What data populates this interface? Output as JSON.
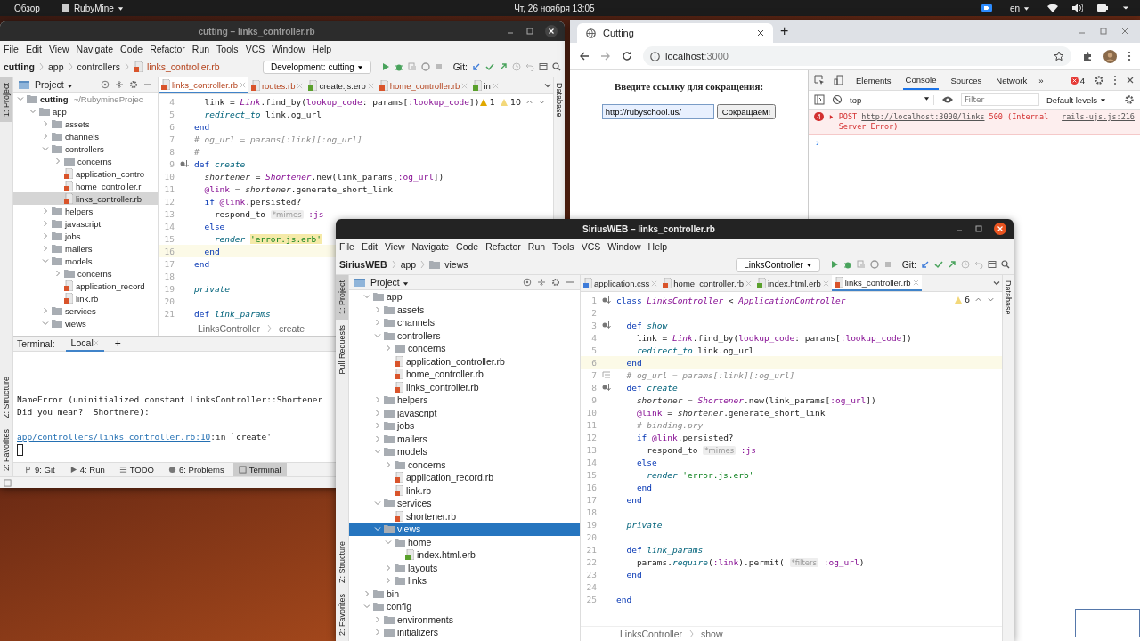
{
  "top_bar": {
    "activities": "Обзор",
    "app_menu": "RubyMine",
    "clock": "Чт, 26 ноября  13:05",
    "language": "en"
  },
  "ide_back": {
    "title": "cutting – links_controller.rb",
    "menu": [
      "File",
      "Edit",
      "View",
      "Navigate",
      "Code",
      "Refactor",
      "Run",
      "Tools",
      "VCS",
      "Window",
      "Help"
    ],
    "breadcrumb": [
      {
        "label": "cutting",
        "kind": "project"
      },
      {
        "label": "app",
        "kind": "plain"
      },
      {
        "label": "controllers",
        "kind": "plain"
      },
      {
        "label": "links_controller.rb",
        "kind": "ruby"
      }
    ],
    "run_config": "Development: cutting",
    "git_label": "Git:",
    "left_stripe": [
      {
        "label": "1: Project",
        "selected": true
      }
    ],
    "left_stripe_bottom": [
      {
        "label": "Z: Structure",
        "selected": false
      },
      {
        "label": "2: Favorites",
        "selected": false
      }
    ],
    "right_stripe": [
      "Database"
    ],
    "project_panel": {
      "title": "Project",
      "tree": [
        {
          "label": "cutting",
          "path": "~/RubymineProjec",
          "kind": "project",
          "expanded": true,
          "selected": false,
          "children": [
            {
              "label": "app",
              "kind": "folder",
              "expanded": true,
              "selected": false,
              "children": [
                {
                  "label": "assets",
                  "kind": "folder",
                  "expanded": false,
                  "selected": false
                },
                {
                  "label": "channels",
                  "kind": "folder",
                  "expanded": false,
                  "selected": false
                },
                {
                  "label": "controllers",
                  "kind": "folder",
                  "expanded": true,
                  "selected": false,
                  "children": [
                    {
                      "label": "concerns",
                      "kind": "folder",
                      "expanded": false,
                      "selected": false
                    },
                    {
                      "label": "application_contro",
                      "kind": "ruby",
                      "selected": false
                    },
                    {
                      "label": "home_controller.r",
                      "kind": "ruby",
                      "selected": false
                    },
                    {
                      "label": "links_controller.rb",
                      "kind": "ruby",
                      "selected": true
                    }
                  ]
                },
                {
                  "label": "helpers",
                  "kind": "folder",
                  "expanded": false,
                  "selected": false
                },
                {
                  "label": "javascript",
                  "kind": "folder",
                  "expanded": false,
                  "selected": false
                },
                {
                  "label": "jobs",
                  "kind": "folder",
                  "expanded": false,
                  "selected": false
                },
                {
                  "label": "mailers",
                  "kind": "folder",
                  "expanded": false,
                  "selected": false
                },
                {
                  "label": "models",
                  "kind": "folder",
                  "expanded": true,
                  "selected": false,
                  "children": [
                    {
                      "label": "concerns",
                      "kind": "folder",
                      "expanded": false,
                      "selected": false
                    },
                    {
                      "label": "application_record",
                      "kind": "ruby",
                      "selected": false
                    },
                    {
                      "label": "link.rb",
                      "kind": "ruby",
                      "selected": false
                    }
                  ]
                },
                {
                  "label": "services",
                  "kind": "folder",
                  "expanded": false,
                  "selected": false
                },
                {
                  "label": "views",
                  "kind": "folder",
                  "expanded": true,
                  "selected": false
                }
              ]
            }
          ]
        }
      ]
    },
    "tabs": [
      {
        "label": "links_controller.rb",
        "kind": "ruby",
        "selected": true
      },
      {
        "label": "routes.rb",
        "kind": "ruby",
        "selected": false
      },
      {
        "label": "create.js.erb",
        "kind": "erb",
        "selected": false
      },
      {
        "label": "home_controller.rb",
        "kind": "ruby",
        "selected": false
      },
      {
        "label": "in",
        "kind": "erb",
        "selected": false
      }
    ],
    "inspections": [
      {
        "kind": "error",
        "count": "1"
      },
      {
        "kind": "warning",
        "count": "10"
      }
    ],
    "code": [
      {
        "number": "4",
        "kind": "plain",
        "tokens": [
          {
            "text": "  link = ",
            "kind": "plain"
          },
          {
            "text": "Link",
            "kind": "const"
          },
          {
            "text": ".find_by(",
            "kind": "plain"
          },
          {
            "text": "lookup_code",
            "kind": "sym"
          },
          {
            "text": ": params[",
            "kind": "plain"
          },
          {
            "text": ":lookup_code",
            "kind": "sym"
          },
          {
            "text": "])",
            "kind": "plain"
          }
        ]
      },
      {
        "number": "5",
        "kind": "plain",
        "tokens": [
          {
            "text": "  redirect_to",
            "kind": "call"
          },
          {
            "text": " link.og_url",
            "kind": "plain"
          }
        ]
      },
      {
        "number": "6",
        "kind": "plain",
        "tokens": [
          {
            "text": "end",
            "kind": "kw"
          }
        ]
      },
      {
        "number": "7",
        "kind": "plain",
        "tokens": [
          {
            "text": "# og_url = params[:link][:og_url]",
            "kind": "comment"
          }
        ]
      },
      {
        "number": "8",
        "kind": "plain",
        "tokens": [
          {
            "text": "#",
            "kind": "comment"
          }
        ]
      },
      {
        "number": "9",
        "kind": "override",
        "tokens": [
          {
            "text": "def ",
            "kind": "kw"
          },
          {
            "text": "create",
            "kind": "fn"
          }
        ]
      },
      {
        "number": "10",
        "kind": "plain",
        "tokens": [
          {
            "text": "  shortener",
            "kind": "var"
          },
          {
            "text": " = ",
            "kind": "plain"
          },
          {
            "text": "Shortener",
            "kind": "const"
          },
          {
            "text": ".new(link_params[",
            "kind": "plain"
          },
          {
            "text": ":og_url",
            "kind": "sym"
          },
          {
            "text": "])",
            "kind": "plain"
          }
        ]
      },
      {
        "number": "11",
        "kind": "plain",
        "tokens": [
          {
            "text": "  @link",
            "kind": "ivar"
          },
          {
            "text": " = ",
            "kind": "plain"
          },
          {
            "text": "shortener",
            "kind": "var"
          },
          {
            "text": ".generate_short_link",
            "kind": "plain"
          }
        ]
      },
      {
        "number": "12",
        "kind": "plain",
        "tokens": [
          {
            "text": "  if ",
            "kind": "kw"
          },
          {
            "text": "@link",
            "kind": "ivar"
          },
          {
            "text": ".persisted?",
            "kind": "plain"
          }
        ]
      },
      {
        "number": "13",
        "kind": "plain",
        "tokens": [
          {
            "text": "    respond_to ",
            "kind": "plain"
          },
          {
            "text": "*mimes",
            "kind": "hint"
          },
          {
            "text": " :js",
            "kind": "sym"
          }
        ]
      },
      {
        "number": "14",
        "kind": "plain",
        "tokens": [
          {
            "text": "  else",
            "kind": "kw"
          }
        ]
      },
      {
        "number": "15",
        "kind": "plain",
        "tokens": [
          {
            "text": "    render ",
            "kind": "call"
          },
          {
            "text": "'error.js.erb'",
            "kind": "str_hl"
          }
        ]
      },
      {
        "number": "16",
        "kind": "plain",
        "current": true,
        "tokens": [
          {
            "text": "  end",
            "kind": "kw"
          }
        ]
      },
      {
        "number": "17",
        "kind": "plain",
        "tokens": [
          {
            "text": "end",
            "kind": "kw"
          }
        ]
      },
      {
        "number": "18",
        "kind": "plain"
      },
      {
        "number": "19",
        "kind": "plain",
        "tokens": [
          {
            "text": "private",
            "kind": "call"
          }
        ]
      },
      {
        "number": "20",
        "kind": "plain"
      },
      {
        "number": "21",
        "kind": "plain",
        "tokens": [
          {
            "text": "def ",
            "kind": "kw"
          },
          {
            "text": "link_params",
            "kind": "fn"
          }
        ]
      }
    ],
    "code_breadcrumb": [
      "LinksController",
      "create"
    ],
    "terminal": {
      "title": "Terminal:",
      "tabs": [
        {
          "label": "Local",
          "selected": true
        }
      ],
      "add": "+",
      "lines": [
        {
          "kind": "text",
          "text": "NameError (uninitialized constant LinksController::Shortener"
        },
        {
          "kind": "text",
          "text": "Did you mean?  Shortnere):"
        },
        {
          "kind": "location",
          "link": "app/controllers/links_controller.rb:10",
          "text": ":in `create'"
        }
      ]
    },
    "tool_buttons": [
      {
        "label": "9: Git",
        "kind": "git",
        "selected": false
      },
      {
        "label": "4: Run",
        "kind": "run",
        "selected": false
      },
      {
        "label": "TODO",
        "kind": "todo",
        "selected": false
      },
      {
        "label": "6: Problems",
        "kind": "problems",
        "selected": false
      },
      {
        "label": "Terminal",
        "kind": "terminal",
        "selected": true
      }
    ]
  },
  "browser": {
    "tab": {
      "title": "Cutting",
      "selected": true
    },
    "new_tab": "+",
    "url_host": "localhost",
    "url_port": ":3000",
    "page": {
      "heading": "Введите ссылку для сокращения:",
      "input_value": "http://rubyschool.us/",
      "button": "Сокращаем!"
    },
    "devtools": {
      "tabs": [
        {
          "label": "Elements",
          "selected": false
        },
        {
          "label": "Console",
          "selected": true
        },
        {
          "label": "Sources",
          "selected": false
        },
        {
          "label": "Network",
          "selected": false
        }
      ],
      "more": "»",
      "error_count": "4",
      "context": "top",
      "filter_placeholder": "Filter",
      "levels": "Default levels",
      "messages": [
        {
          "kind": "error",
          "count": "4",
          "method": "POST",
          "url": "http://localhost:3000/links",
          "text": "500 (Internal Server Error)",
          "source": "rails-ujs.js:216"
        }
      ],
      "prompt": "›"
    }
  },
  "ide_front": {
    "title": "SiriusWEB – links_controller.rb",
    "menu": [
      "File",
      "Edit",
      "View",
      "Navigate",
      "Code",
      "Refactor",
      "Run",
      "Tools",
      "VCS",
      "Window",
      "Help"
    ],
    "breadcrumb": [
      {
        "label": "SiriusWEB",
        "kind": "project"
      },
      {
        "label": "app",
        "kind": "plain"
      },
      {
        "label": "views",
        "kind": "folder"
      }
    ],
    "run_config": "LinksController",
    "git_label": "Git:",
    "left_stripe": [
      {
        "label": "1: Project",
        "selected": true
      },
      {
        "label": "Pull Requests",
        "selected": false
      }
    ],
    "left_stripe_bottom": [
      {
        "label": "Z: Structure",
        "selected": false
      },
      {
        "label": "2: Favorites",
        "selected": false
      }
    ],
    "right_stripe": [
      "Database"
    ],
    "project_panel": {
      "title": "Project",
      "tree": [
        {
          "label": "app",
          "kind": "folder",
          "expanded": true,
          "selected": false,
          "children": [
            {
              "label": "assets",
              "kind": "folder",
              "expanded": false,
              "selected": false
            },
            {
              "label": "channels",
              "kind": "folder",
              "expanded": false,
              "selected": false
            },
            {
              "label": "controllers",
              "kind": "folder",
              "expanded": true,
              "selected": false,
              "children": [
                {
                  "label": "concerns",
                  "kind": "folder",
                  "expanded": false,
                  "selected": false
                },
                {
                  "label": "application_controller.rb",
                  "kind": "ruby",
                  "selected": false
                },
                {
                  "label": "home_controller.rb",
                  "kind": "ruby",
                  "selected": false
                },
                {
                  "label": "links_controller.rb",
                  "kind": "ruby",
                  "selected": false
                }
              ]
            },
            {
              "label": "helpers",
              "kind": "folder",
              "expanded": false,
              "selected": false
            },
            {
              "label": "javascript",
              "kind": "folder",
              "expanded": false,
              "selected": false
            },
            {
              "label": "jobs",
              "kind": "folder",
              "expanded": false,
              "selected": false
            },
            {
              "label": "mailers",
              "kind": "folder",
              "expanded": false,
              "selected": false
            },
            {
              "label": "models",
              "kind": "folder",
              "expanded": true,
              "selected": false,
              "children": [
                {
                  "label": "concerns",
                  "kind": "folder",
                  "expanded": false,
                  "selected": false
                },
                {
                  "label": "application_record.rb",
                  "kind": "ruby",
                  "selected": false
                },
                {
                  "label": "link.rb",
                  "kind": "ruby",
                  "selected": false
                }
              ]
            },
            {
              "label": "services",
              "kind": "folder",
              "expanded": true,
              "selected": false,
              "children": [
                {
                  "label": "shortener.rb",
                  "kind": "ruby",
                  "selected": false
                }
              ]
            },
            {
              "label": "views",
              "kind": "folder",
              "expanded": true,
              "selected": true,
              "children": [
                {
                  "label": "home",
                  "kind": "folder",
                  "expanded": true,
                  "selected": false,
                  "children": [
                    {
                      "label": "index.html.erb",
                      "kind": "erb",
                      "selected": false
                    }
                  ]
                },
                {
                  "label": "layouts",
                  "kind": "folder",
                  "expanded": false,
                  "selected": false
                },
                {
                  "label": "links",
                  "kind": "folder",
                  "expanded": false,
                  "selected": false
                }
              ]
            }
          ]
        },
        {
          "label": "bin",
          "kind": "folder",
          "expanded": false,
          "selected": false
        },
        {
          "label": "config",
          "kind": "folder",
          "expanded": true,
          "selected": false,
          "children": [
            {
              "label": "environments",
              "kind": "folder",
              "expanded": false,
              "selected": false
            },
            {
              "label": "initializers",
              "kind": "folder",
              "expanded": false,
              "selected": false
            }
          ]
        }
      ]
    },
    "tabs": [
      {
        "label": "application.css",
        "kind": "css",
        "selected": false
      },
      {
        "label": "home_controller.rb",
        "kind": "ruby",
        "selected": false
      },
      {
        "label": "index.html.erb",
        "kind": "erb",
        "selected": false
      },
      {
        "label": "links_controller.rb",
        "kind": "ruby",
        "selected": true
      }
    ],
    "inspections": [
      {
        "kind": "warning",
        "count": "6"
      }
    ],
    "code": [
      {
        "number": "1",
        "kind": "override",
        "tokens": [
          {
            "text": "class ",
            "kind": "kw"
          },
          {
            "text": "LinksController",
            "kind": "const"
          },
          {
            "text": " < ",
            "kind": "plain"
          },
          {
            "text": "ApplicationController",
            "kind": "const"
          }
        ]
      },
      {
        "number": "2",
        "kind": "plain"
      },
      {
        "number": "3",
        "kind": "override",
        "tokens": [
          {
            "text": "  def ",
            "kind": "kw"
          },
          {
            "text": "show",
            "kind": "fn"
          }
        ]
      },
      {
        "number": "4",
        "kind": "plain",
        "tokens": [
          {
            "text": "    link = ",
            "kind": "plain"
          },
          {
            "text": "Link",
            "kind": "const"
          },
          {
            "text": ".find_by(",
            "kind": "plain"
          },
          {
            "text": "lookup_code",
            "kind": "sym"
          },
          {
            "text": ": params[",
            "kind": "plain"
          },
          {
            "text": ":lookup_code",
            "kind": "sym"
          },
          {
            "text": "])",
            "kind": "plain"
          }
        ]
      },
      {
        "number": "5",
        "kind": "plain",
        "tokens": [
          {
            "text": "    redirect_to",
            "kind": "call"
          },
          {
            "text": " link.og_url",
            "kind": "plain"
          }
        ]
      },
      {
        "number": "6",
        "kind": "plain",
        "current": true,
        "tokens": [
          {
            "text": "  end",
            "kind": "kw"
          }
        ]
      },
      {
        "number": "7",
        "kind": "note",
        "tokens": [
          {
            "text": "  # og_url = params[:link][:og_url]",
            "kind": "comment"
          }
        ]
      },
      {
        "number": "8",
        "kind": "override",
        "tokens": [
          {
            "text": "  def ",
            "kind": "kw"
          },
          {
            "text": "create",
            "kind": "fn"
          }
        ]
      },
      {
        "number": "9",
        "kind": "plain",
        "tokens": [
          {
            "text": "    shortener",
            "kind": "var"
          },
          {
            "text": " = ",
            "kind": "plain"
          },
          {
            "text": "Shortener",
            "kind": "const"
          },
          {
            "text": ".new(link_params[",
            "kind": "plain"
          },
          {
            "text": ":og_url",
            "kind": "sym"
          },
          {
            "text": "])",
            "kind": "plain"
          }
        ]
      },
      {
        "number": "10",
        "kind": "plain",
        "tokens": [
          {
            "text": "    @link",
            "kind": "ivar"
          },
          {
            "text": " = ",
            "kind": "plain"
          },
          {
            "text": "shortener",
            "kind": "var"
          },
          {
            "text": ".generate_short_link",
            "kind": "plain"
          }
        ]
      },
      {
        "number": "11",
        "kind": "plain",
        "tokens": [
          {
            "text": "    # binding.pry",
            "kind": "comment"
          }
        ]
      },
      {
        "number": "12",
        "kind": "plain",
        "tokens": [
          {
            "text": "    if ",
            "kind": "kw"
          },
          {
            "text": "@link",
            "kind": "ivar"
          },
          {
            "text": ".persisted?",
            "kind": "plain"
          }
        ]
      },
      {
        "number": "13",
        "kind": "plain",
        "tokens": [
          {
            "text": "      respond_to ",
            "kind": "plain"
          },
          {
            "text": "*mimes",
            "kind": "hint"
          },
          {
            "text": " :js",
            "kind": "sym"
          }
        ]
      },
      {
        "number": "14",
        "kind": "plain",
        "tokens": [
          {
            "text": "    else",
            "kind": "kw"
          }
        ]
      },
      {
        "number": "15",
        "kind": "plain",
        "tokens": [
          {
            "text": "      render ",
            "kind": "call"
          },
          {
            "text": "'error.js.erb'",
            "kind": "str"
          }
        ]
      },
      {
        "number": "16",
        "kind": "plain",
        "tokens": [
          {
            "text": "    end",
            "kind": "kw"
          }
        ]
      },
      {
        "number": "17",
        "kind": "plain",
        "tokens": [
          {
            "text": "  end",
            "kind": "kw"
          }
        ]
      },
      {
        "number": "18",
        "kind": "plain"
      },
      {
        "number": "19",
        "kind": "plain",
        "tokens": [
          {
            "text": "  private",
            "kind": "call"
          }
        ]
      },
      {
        "number": "20",
        "kind": "plain"
      },
      {
        "number": "21",
        "kind": "plain",
        "tokens": [
          {
            "text": "  def ",
            "kind": "kw"
          },
          {
            "text": "link_params",
            "kind": "fn"
          }
        ]
      },
      {
        "number": "22",
        "kind": "plain",
        "tokens": [
          {
            "text": "    params.",
            "kind": "plain"
          },
          {
            "text": "require",
            "kind": "call"
          },
          {
            "text": "(",
            "kind": "plain"
          },
          {
            "text": ":link",
            "kind": "sym"
          },
          {
            "text": ").permit( ",
            "kind": "plain"
          },
          {
            "text": "*filters",
            "kind": "hint"
          },
          {
            "text": " :og_url",
            "kind": "sym"
          },
          {
            "text": ")",
            "kind": "plain"
          }
        ]
      },
      {
        "number": "23",
        "kind": "plain",
        "tokens": [
          {
            "text": "  end",
            "kind": "kw"
          }
        ]
      },
      {
        "number": "24",
        "kind": "plain"
      },
      {
        "number": "25",
        "kind": "plain",
        "tokens": [
          {
            "text": "end",
            "kind": "kw"
          }
        ]
      }
    ],
    "code_breadcrumb": [
      "LinksController",
      "show"
    ]
  }
}
